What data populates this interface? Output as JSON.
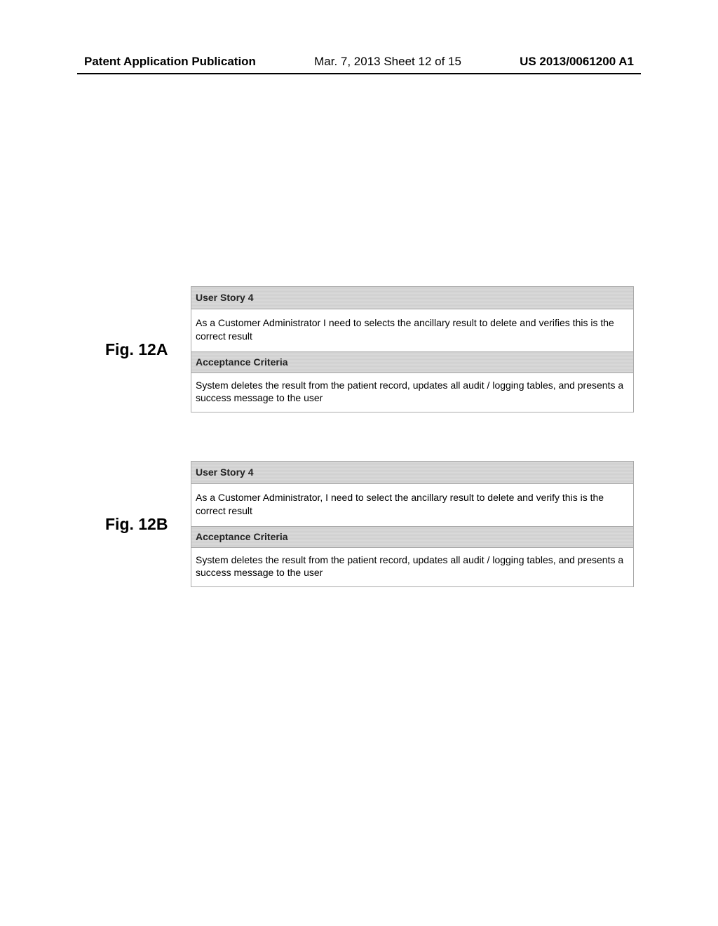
{
  "header": {
    "publication_label": "Patent Application Publication",
    "date_sheet": "Mar. 7, 2013  Sheet 12 of 15",
    "pub_number": "US 2013/0061200 A1"
  },
  "figures": [
    {
      "label": "Fig. 12A",
      "story_title": "User Story 4",
      "story_text": "As a Customer Administrator I need to selects the ancillary result to delete and verifies this is the correct result",
      "criteria_title": "Acceptance Criteria",
      "criteria_text": "System deletes the result from the patient record, updates all audit / logging tables, and presents a success message to the user"
    },
    {
      "label": "Fig. 12B",
      "story_title": "User Story 4",
      "story_text": "As a Customer Administrator, I need to select  the ancillary result to delete and verify this is the correct result",
      "criteria_title": "Acceptance Criteria",
      "criteria_text": "System deletes the result from the patient record, updates all audit / logging tables, and presents a success message to the user"
    }
  ]
}
